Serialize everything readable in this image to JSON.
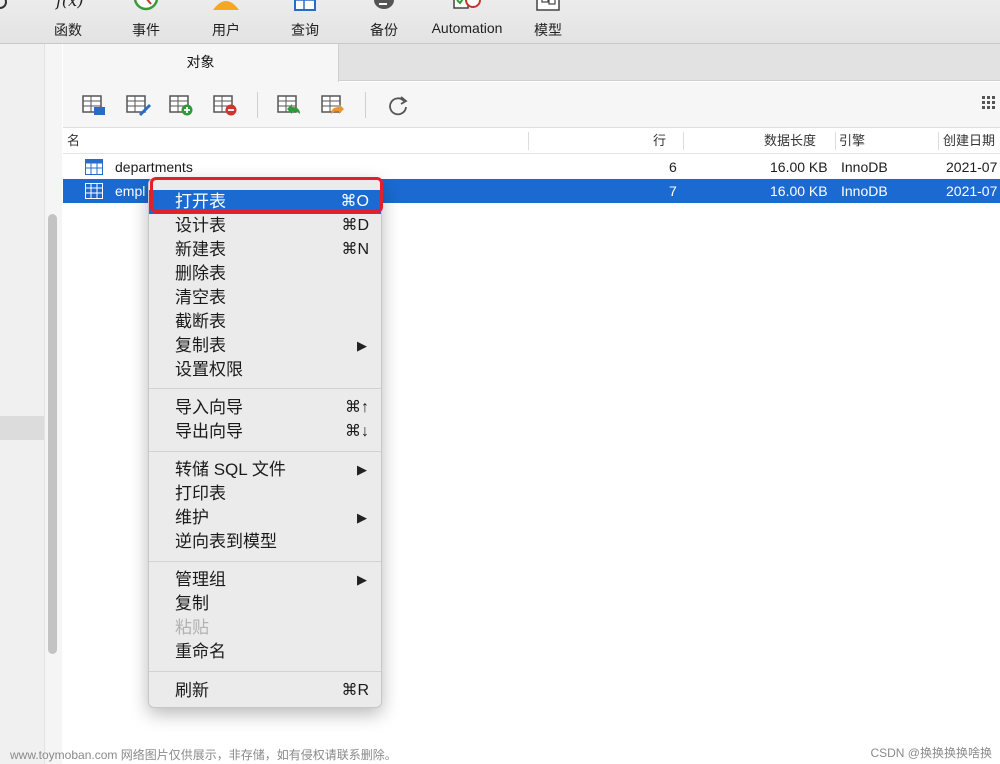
{
  "toolbar": {
    "items": [
      {
        "label": "",
        "icon": "view-icon"
      },
      {
        "label": "函数",
        "icon": "function-icon"
      },
      {
        "label": "事件",
        "icon": "event-clock-icon"
      },
      {
        "label": "用户",
        "icon": "user-icon"
      },
      {
        "label": "查询",
        "icon": "query-icon"
      },
      {
        "label": "备份",
        "icon": "backup-icon"
      },
      {
        "label": "Automation",
        "icon": "automation-icon"
      },
      {
        "label": "模型",
        "icon": "model-icon"
      }
    ]
  },
  "tabs": {
    "active": "对象"
  },
  "object_toolbar": {
    "buttons": [
      "open-table-icon",
      "design-table-icon",
      "new-table-icon",
      "delete-table-icon",
      "import-icon",
      "export-icon",
      "refresh-icon"
    ]
  },
  "table": {
    "columns": [
      "名",
      "行",
      "数据长度",
      "引擎",
      "创建日期"
    ],
    "rows": [
      {
        "name": "departments",
        "rows": "6",
        "data_length": "16.00 KB",
        "engine": "InnoDB",
        "created": "2021-07"
      },
      {
        "name": "empl",
        "rows": "7",
        "data_length": "16.00 KB",
        "engine": "InnoDB",
        "created": "2021-07"
      }
    ]
  },
  "context_menu": {
    "groups": [
      [
        {
          "label": "打开表",
          "shortcut": "⌘O"
        },
        {
          "label": "设计表",
          "shortcut": "⌘D"
        },
        {
          "label": "新建表",
          "shortcut": "⌘N"
        },
        {
          "label": "删除表",
          "shortcut": ""
        },
        {
          "label": "清空表",
          "shortcut": ""
        },
        {
          "label": "截断表",
          "shortcut": ""
        },
        {
          "label": "复制表",
          "shortcut": "▶"
        },
        {
          "label": "设置权限",
          "shortcut": ""
        }
      ],
      [
        {
          "label": "导入向导",
          "shortcut": "⌘↑"
        },
        {
          "label": "导出向导",
          "shortcut": "⌘↓"
        }
      ],
      [
        {
          "label": "转储 SQL 文件",
          "shortcut": "▶"
        },
        {
          "label": "打印表",
          "shortcut": ""
        },
        {
          "label": "维护",
          "shortcut": "▶"
        },
        {
          "label": "逆向表到模型",
          "shortcut": ""
        }
      ],
      [
        {
          "label": "管理组",
          "shortcut": "▶"
        },
        {
          "label": "复制",
          "shortcut": ""
        },
        {
          "label": "粘贴",
          "shortcut": ""
        },
        {
          "label": "重命名",
          "shortcut": ""
        }
      ],
      [
        {
          "label": "刷新",
          "shortcut": "⌘R"
        }
      ]
    ]
  },
  "watermark": {
    "left": "www.toymoban.com 网络图片仅供展示，非存储，如有侵权请联系删除。",
    "right": "CSDN @换换换换啥换"
  },
  "colors": {
    "selection": "#1a6ad1",
    "highlight_box": "#e3202a"
  }
}
